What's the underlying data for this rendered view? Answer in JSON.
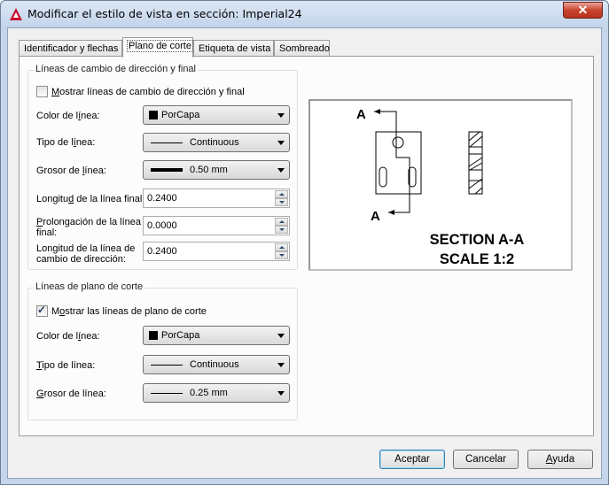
{
  "window": {
    "title": "Modificar el estilo de vista en sección: Imperial24",
    "close_glyph": "✕"
  },
  "tabs": [
    {
      "label": "Identificador y flechas"
    },
    {
      "label": "Plano de corte"
    },
    {
      "label": "Etiqueta de vista"
    },
    {
      "label": "Sombreado"
    }
  ],
  "bend_group": {
    "title": "Líneas de cambio de dirección y final",
    "show_checkbox": {
      "pre": "",
      "u": "M",
      "post": "ostrar líneas de cambio de dirección y final",
      "checked": false
    },
    "line_color": {
      "pre": "Color de l",
      "u": "í",
      "post": "nea:",
      "value": "PorCapa"
    },
    "linetype": {
      "pre": "Tipo de l",
      "u": "í",
      "post": "nea:",
      "value": "Continuous"
    },
    "lineweight": {
      "pre": "Grosor de ",
      "u": "l",
      "post": "ínea:",
      "value": "0.50 mm"
    },
    "end_length": {
      "pre": "Longitu",
      "u": "d",
      "post": " de la línea final:",
      "value": "0.2400"
    },
    "end_extension": {
      "line1_pre": "",
      "line1_u": "P",
      "line1_post": "rolongación de la línea",
      "line2": "final:",
      "value": "0.0000"
    },
    "bend_length": {
      "line1": "Longitud de la línea de",
      "line2": "cambio de dirección:",
      "value": "0.2400"
    }
  },
  "plane_group": {
    "title": "Líneas de plano de corte",
    "show_checkbox": {
      "pre": "M",
      "u": "o",
      "post": "strar las líneas de plano de corte",
      "checked": true
    },
    "line_color": {
      "pre": "Color de l",
      "u": "í",
      "post": "nea:",
      "value": "PorCapa"
    },
    "linetype": {
      "pre": "",
      "u": "T",
      "post": "ipo de línea:",
      "value": "Continuous"
    },
    "lineweight": {
      "pre": "",
      "u": "G",
      "post": "rosor de línea:",
      "value": "0.25 mm"
    }
  },
  "preview": {
    "marker_top": "A",
    "marker_bottom": "A",
    "caption_line1": "SECTION A-A",
    "caption_line2": "SCALE 1:2"
  },
  "buttons": {
    "ok": "Aceptar",
    "cancel": "Cancelar",
    "help_pre": "",
    "help_u": "A",
    "help_post": "yuda"
  },
  "colors": {
    "title_bg": "#c3d4ea",
    "close_red": "#c9452f",
    "app_icon_red": "#c8102e"
  }
}
